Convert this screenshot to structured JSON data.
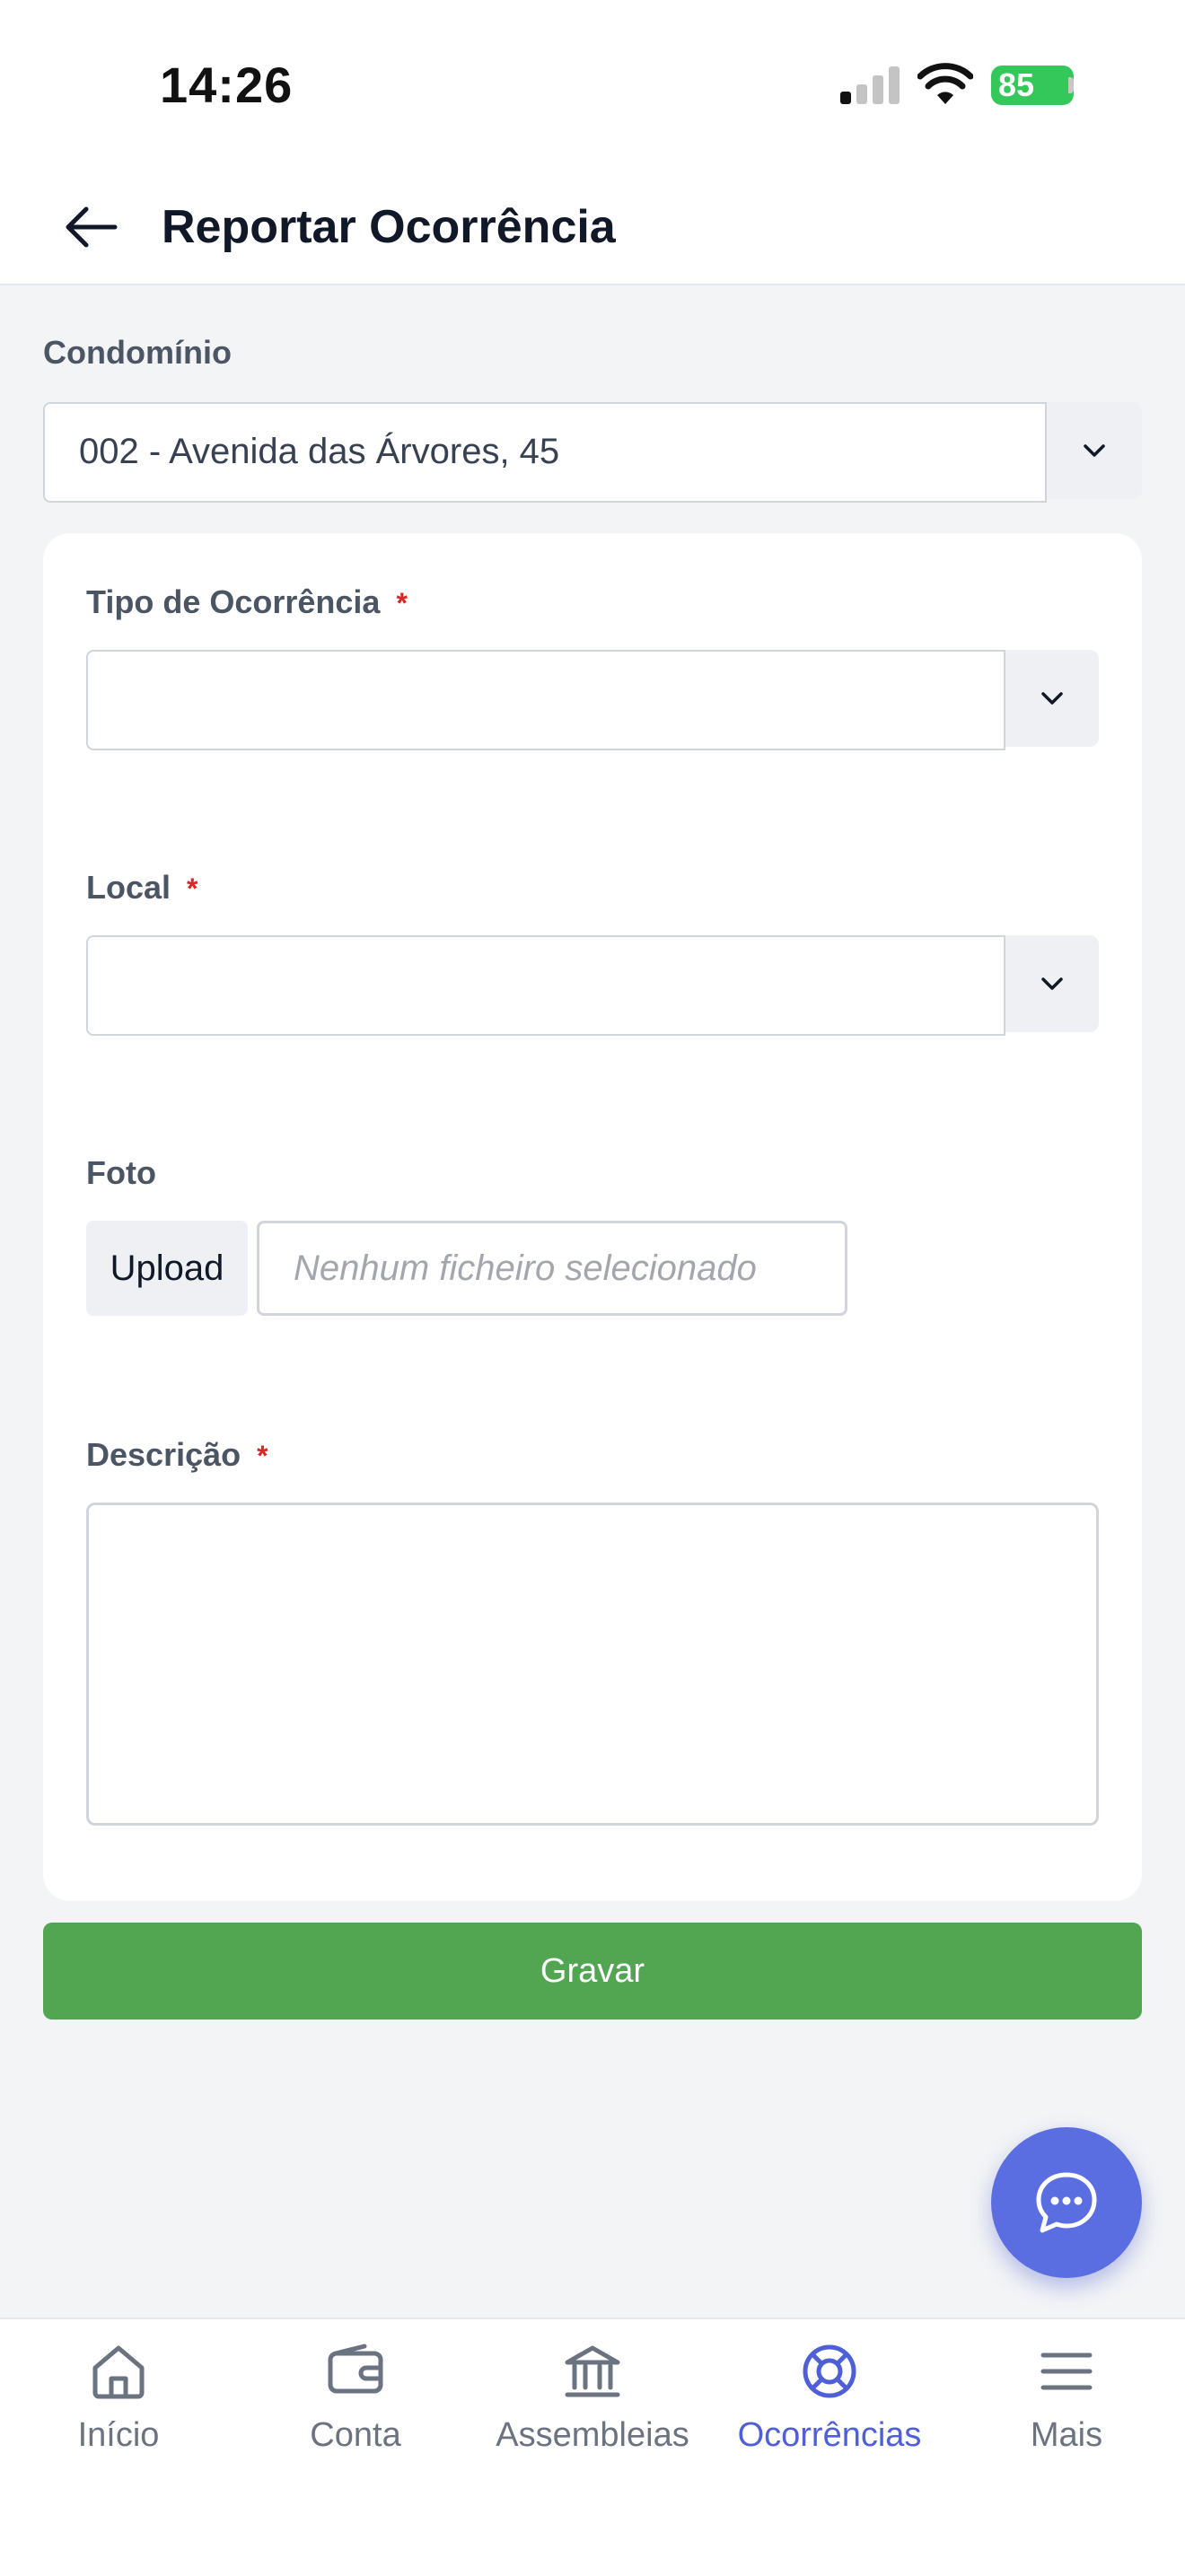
{
  "status_bar": {
    "time": "14:26",
    "battery": "85"
  },
  "header": {
    "title": "Reportar Ocorrência"
  },
  "condominio": {
    "label": "Condomínio",
    "value": "002 - Avenida das Árvores, 45"
  },
  "form": {
    "tipo": {
      "label": "Tipo de Ocorrência",
      "required_mark": "*",
      "value": ""
    },
    "local": {
      "label": "Local",
      "required_mark": "*",
      "value": ""
    },
    "foto": {
      "label": "Foto",
      "upload_label": "Upload",
      "file_placeholder": "Nenhum ficheiro selecionado"
    },
    "descricao": {
      "label": "Descrição",
      "required_mark": "*",
      "value": ""
    }
  },
  "actions": {
    "save_label": "Gravar"
  },
  "fab": {
    "icon": "chat-icon"
  },
  "tabbar": {
    "items": [
      {
        "label": "Início",
        "icon": "home-icon",
        "active": false
      },
      {
        "label": "Conta",
        "icon": "wallet-icon",
        "active": false
      },
      {
        "label": "Assembleias",
        "icon": "bank-icon",
        "active": false
      },
      {
        "label": "Ocorrências",
        "icon": "lifebuoy-icon",
        "active": true
      },
      {
        "label": "Mais",
        "icon": "menu-icon",
        "active": false
      }
    ]
  },
  "colors": {
    "primary": "#4f5fd8",
    "save": "#52a652",
    "required": "#dc2626",
    "battery": "#34c759"
  }
}
